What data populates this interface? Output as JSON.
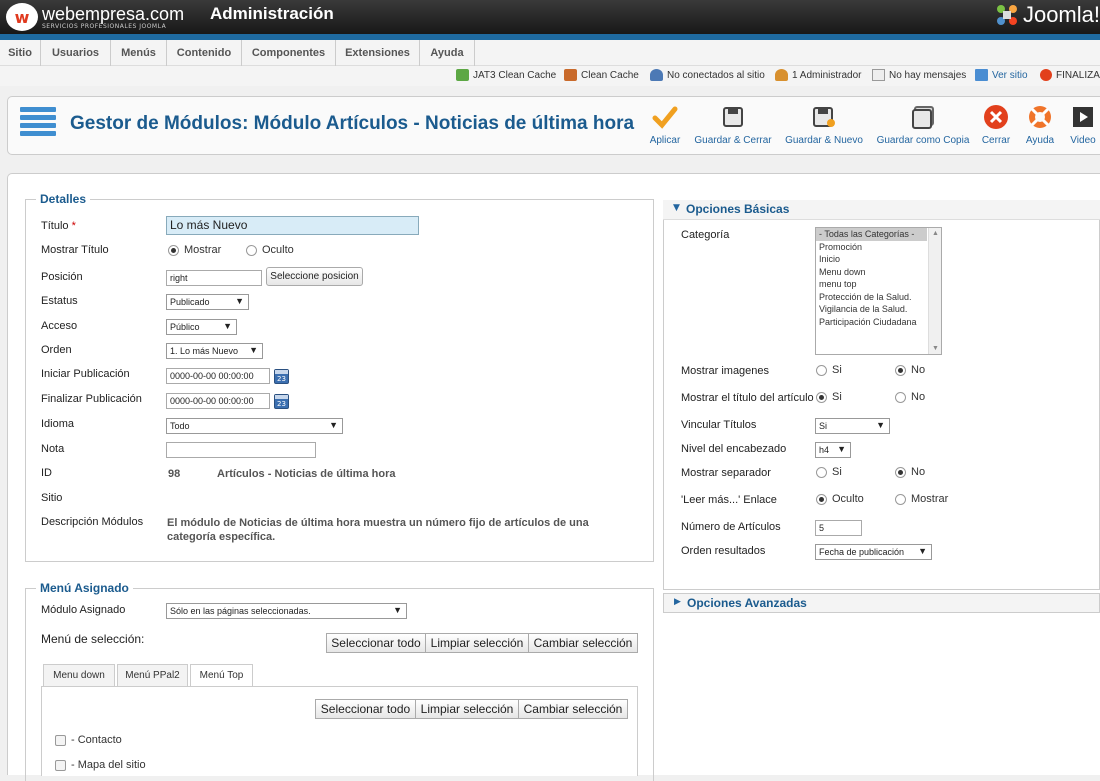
{
  "header": {
    "logo_text": "webempresa.com",
    "logo_sub": "SERVICIOS PROFESIONALES JOOMLA",
    "title": "Administración",
    "brand": "Joomla!"
  },
  "menu": [
    "Sitio",
    "Usuarios",
    "Menús",
    "Contenido",
    "Componentes",
    "Extensiones",
    "Ayuda"
  ],
  "status": [
    "JAT3 Clean Cache",
    "Clean Cache",
    "No conectados al sitio",
    "1 Administrador",
    "No hay mensajes",
    "Ver sitio",
    "FINALIZAR"
  ],
  "toolbar": {
    "title": "Gestor de Módulos: Módulo Artículos - Noticias de última hora",
    "buttons": [
      "Aplicar",
      "Guardar & Cerrar",
      "Guardar & Nuevo",
      "Guardar como Copia",
      "Cerrar",
      "Ayuda",
      "Video"
    ]
  },
  "details": {
    "legend": "Detalles",
    "titulo_label": "Título",
    "required_mark": "*",
    "titulo_value": "Lo más Nuevo",
    "mostrar_titulo_label": "Mostrar Título",
    "mostrar": "Mostrar",
    "oculto": "Oculto",
    "posicion_label": "Posición",
    "posicion_value": "right",
    "seleccione_posicion": "Seleccione posicion",
    "estatus_label": "Estatus",
    "estatus_value": "Publicado",
    "acceso_label": "Acceso",
    "acceso_value": "Público",
    "orden_label": "Orden",
    "orden_value": "1. Lo más Nuevo",
    "iniciar_label": "Iniciar Publicación",
    "iniciar_value": "0000-00-00 00:00:00",
    "finalizar_label": "Finalizar Publicación",
    "finalizar_value": "0000-00-00 00:00:00",
    "idioma_label": "Idioma",
    "idioma_value": "Todo",
    "nota_label": "Nota",
    "id_label": "ID",
    "id_value": "98",
    "id_name": "Artículos - Noticias de última hora",
    "sitio_label": "Sitio",
    "desc_label": "Descripción Módulos",
    "desc_value": "El módulo de Noticias de última hora muestra un número fijo de artículos de una categoría específica.",
    "cal_label": "23"
  },
  "menu_assign": {
    "legend": "Menú Asignado",
    "modulo_label": "Módulo Asignado",
    "modulo_value": "Sólo en las páginas seleccionadas.",
    "seleccion_label": "Menú de selección:",
    "select_all": "Seleccionar todo",
    "clear": "Limpiar selección",
    "toggle": "Cambiar selección",
    "tabs": [
      "Menu down",
      "Menú PPal2",
      "Menú Top"
    ],
    "items": [
      "- Contacto",
      "- Mapa del sitio"
    ]
  },
  "basic": {
    "header": "Opciones Básicas",
    "categoria_label": "Categoría",
    "categorias": [
      "- Todas las Categorías -",
      "Promoción",
      "Inicio",
      "Menu down",
      "menu top",
      "Protección de la Salud.",
      "Vigilancia de la Salud.",
      "Participación Ciudadana"
    ],
    "si": "Si",
    "no": "No",
    "mostrar_imagenes": "Mostrar imagenes",
    "mostrar_titulo_articulo": "Mostrar el título del artículo",
    "vincular_titulos": "Vincular Títulos",
    "vincular_value": "Si",
    "nivel_encabezado": "Nivel del encabezado",
    "nivel_value": "h4",
    "mostrar_separador": "Mostrar separador",
    "leer_mas": "'Leer más...' Enlace",
    "oculto": "Oculto",
    "mostrar": "Mostrar",
    "numero_articulos": "Número de Artículos",
    "numero_value": "5",
    "orden_resultados": "Orden resultados",
    "orden_value": "Fecha de publicación"
  },
  "advanced": {
    "header": "Opciones Avanzadas"
  }
}
